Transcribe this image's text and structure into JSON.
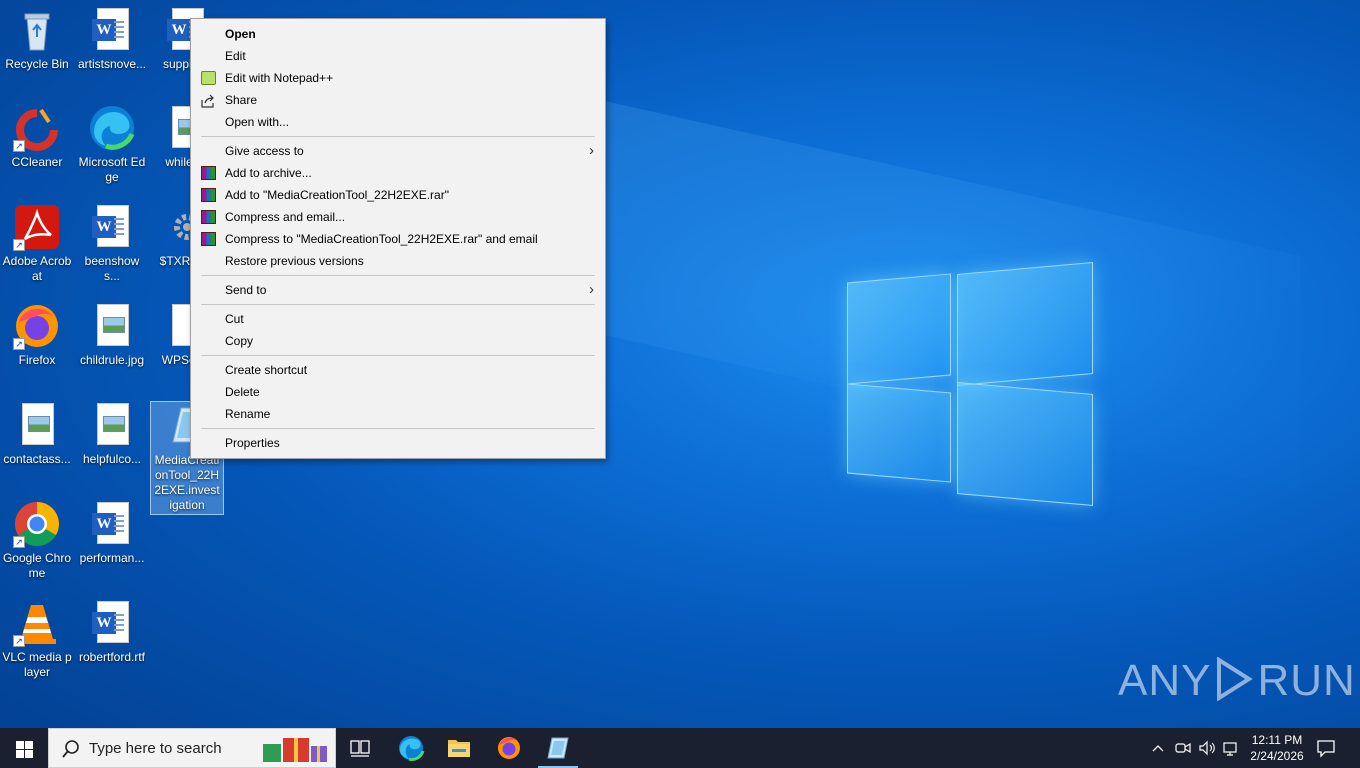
{
  "desktop": {
    "icons": [
      {
        "label": "Recycle Bin",
        "icon": "recycle-bin-icon"
      },
      {
        "label": "artistsnove...",
        "icon": "word-document-icon"
      },
      {
        "label": "supplie...",
        "icon": "word-document-icon"
      },
      {
        "label": "CCleaner",
        "icon": "ccleaner-icon"
      },
      {
        "label": "Microsoft Edge",
        "icon": "edge-icon"
      },
      {
        "label": "whilec...",
        "icon": "image-file-icon"
      },
      {
        "label": "Adobe Acrobat",
        "icon": "acrobat-icon"
      },
      {
        "label": "beenshows...",
        "icon": "word-document-icon"
      },
      {
        "label": "$TXRAJ...",
        "icon": "settings-file-icon"
      },
      {
        "label": "Firefox",
        "icon": "firefox-icon"
      },
      {
        "label": "childrule.jpg",
        "icon": "image-file-icon"
      },
      {
        "label": "WPSett...",
        "icon": "blank-file-icon"
      },
      {
        "label": "contactass...",
        "icon": "image-file-icon"
      },
      {
        "label": "helpfulco...",
        "icon": "image-file-icon"
      },
      {
        "label": "MediaCreationTool_22H2EXE.investigation",
        "icon": "media-creation-tool-icon"
      },
      {
        "label": "Google Chrome",
        "icon": "chrome-icon"
      },
      {
        "label": "performan...",
        "icon": "word-document-icon"
      },
      {
        "label": "VLC media player",
        "icon": "vlc-icon"
      },
      {
        "label": "robertford.rtf",
        "icon": "word-document-icon"
      }
    ]
  },
  "context_menu": {
    "items": [
      {
        "label": "Open",
        "bold": true
      },
      {
        "label": "Edit"
      },
      {
        "label": "Edit with Notepad++",
        "icon": "notepad-plus-plus-icon"
      },
      {
        "label": "Share",
        "icon": "share-icon"
      },
      {
        "label": "Open with..."
      },
      {
        "label": "Give access to",
        "submenu": true
      },
      {
        "label": "Add to archive...",
        "icon": "winrar-icon"
      },
      {
        "label": "Add to \"MediaCreationTool_22H2EXE.rar\"",
        "icon": "winrar-icon"
      },
      {
        "label": "Compress and email...",
        "icon": "winrar-icon"
      },
      {
        "label": "Compress to \"MediaCreationTool_22H2EXE.rar\" and email",
        "icon": "winrar-icon"
      },
      {
        "label": "Restore previous versions"
      },
      {
        "label": "Send to",
        "submenu": true
      },
      {
        "label": "Cut"
      },
      {
        "label": "Copy"
      },
      {
        "label": "Create shortcut"
      },
      {
        "label": "Delete"
      },
      {
        "label": "Rename"
      },
      {
        "label": "Properties"
      }
    ]
  },
  "watermark": {
    "left": "ANY",
    "right": "RUN"
  },
  "taskbar": {
    "search_placeholder": "Type here to search",
    "pinned": [
      "task-view-icon",
      "edge-icon",
      "file-explorer-icon",
      "firefox-icon",
      "media-creation-tool-icon"
    ],
    "clock_time": "12:11 PM",
    "clock_date": "2/24/2026"
  },
  "colors": {
    "accent": "#0d6fd6",
    "taskbar": "#1b2030",
    "menu_bg": "#f2f2f2"
  }
}
